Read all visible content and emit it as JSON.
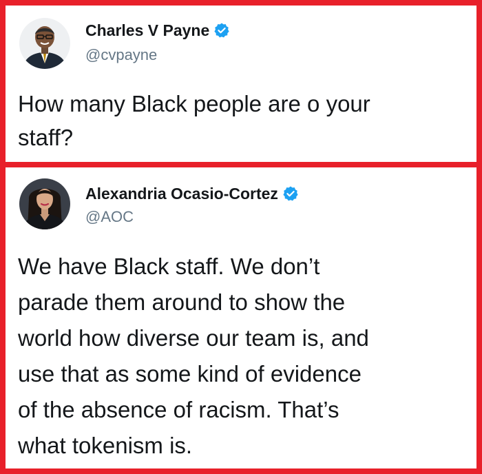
{
  "tweets": [
    {
      "author_name": "Charles V Payne",
      "author_handle": "@cvpayne",
      "verified": true,
      "avatar_icon": "person-avatar-icon",
      "text": "How many Black people are o your\nstaff?"
    },
    {
      "author_name": "Alexandria Ocasio-Cortez",
      "author_handle": "@AOC",
      "verified": true,
      "avatar_icon": "person-avatar-icon",
      "text": "We have Black staff. We don’t\nparade them around to show the\nworld how diverse our team is, and\nuse that as some kind of evidence\nof the absence of racism. That’s\nwhat tokenism is."
    }
  ],
  "colors": {
    "frame": "#e8202a",
    "verified_badge": "#1da1f2",
    "handle": "#657786",
    "text": "#14171a"
  }
}
